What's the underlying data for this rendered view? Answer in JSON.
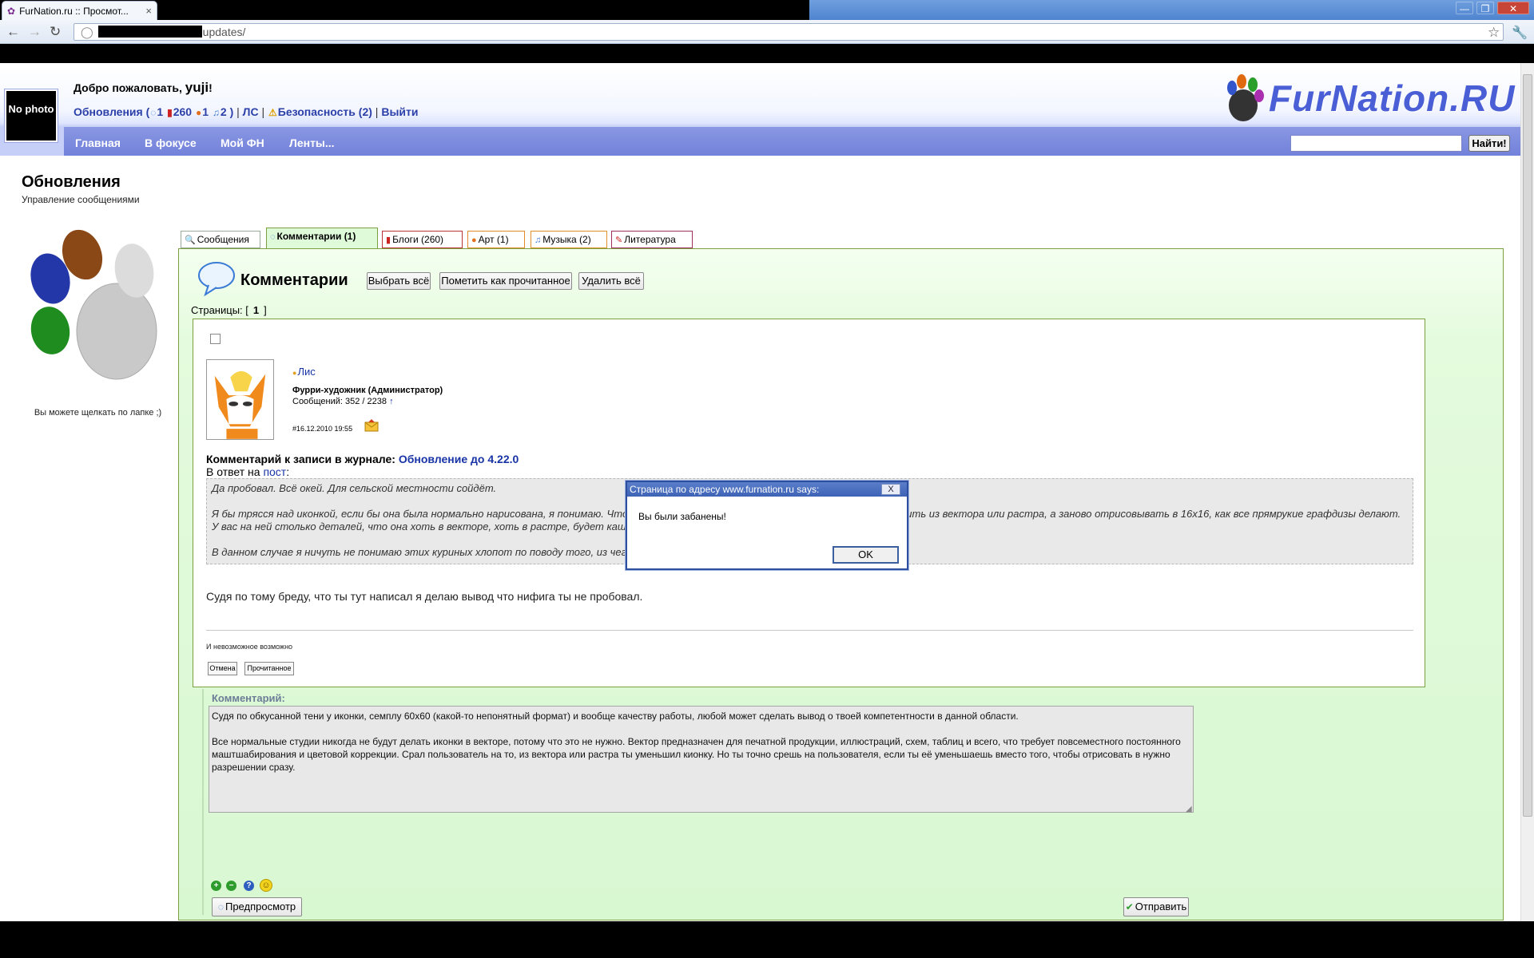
{
  "browser": {
    "tab_title": "FurNation.ru :: Просмот...",
    "tab_close": "×",
    "url_tail": "updates/",
    "min": "—",
    "max": "❐",
    "close": "✕"
  },
  "header": {
    "welcome_prefix": "Добро пожаловать,",
    "username": "yuji",
    "welcome_suffix": "!",
    "no_photo": "No photo",
    "status": {
      "updates_label": "Обновления (",
      "comments_count": "1",
      "blogs_count": "260",
      "art_count": "1",
      "music_count": "2",
      "close_paren": ")",
      "pm": "ЛС",
      "security": "Безопасность (2)",
      "logout": "Выйти"
    },
    "logo_text": "FurNation.RU",
    "nav": [
      "Главная",
      "В фокусе",
      "Мой ФН",
      "Ленты..."
    ],
    "search_button": "Найти!"
  },
  "page": {
    "title": "Обновления",
    "subtitle": "Управление сообщениями",
    "paw_caption": "Вы можете щелкать по лапке ;)"
  },
  "tabs": [
    {
      "label": "Сообщения"
    },
    {
      "label": "Комментарии (1)"
    },
    {
      "label": "Блоги (260)"
    },
    {
      "label": "Арт (1)"
    },
    {
      "label": "Музыка (2)"
    },
    {
      "label": "Литература"
    }
  ],
  "section": {
    "heading": "Комментарии",
    "select_all": "Выбрать всё",
    "mark_read": "Пометить как прочитанное",
    "delete_all": "Удалить всё",
    "pages_label": "Страницы: [",
    "pages_current": "1",
    "pages_close": "]"
  },
  "comment": {
    "author": "Лис",
    "role": "Фурри-художник (Администратор)",
    "posts": "Сообщений: 352 / 2238",
    "posts_arrow": "↑",
    "date": "#16.12.2010 19:55",
    "journal_prefix": "Комментарий к записи в журнале:",
    "journal_link": "Обновление до 4.22.0",
    "reply_prefix": "В ответ на",
    "reply_link": "пост",
    "reply_suffix": ":",
    "quote": [
      "Да пробовал. Всё окей. Для сельской местности сойдёт.",
      "Я бы трясся над иконкой, если бы она была нормально нарисована, я понимаю. Чтобы она не потеряла лицо, её вообще надо не даунсемплить из вектора или растра, а заново отрисовывать в 16х16, как все прямрукие графдизы делают. У вас на ней столько деталей, что она хоть в векторе, хоть в растре, будет кашей при даунсемпле.",
      "В данном случае я ничуть не понимаю этих куриных хлопот по поводу того, из чего она сделана изначально."
    ],
    "body": "Судя по тому бреду, что ты тут написал я делаю вывод что нифига ты не пробовал.",
    "signature": "И невозможное возможно",
    "cancel": "Отмена",
    "read": "Прочитанное"
  },
  "reply_form": {
    "label": "Комментарий:",
    "text": "Судя по обкусанной тени у иконки, семплу 60х60 (какой-то непонятный формат) и вообще качеству работы, любой может сделать вывод о твоей компетентности в данной области.\n\nВсе нормальные студии никогда не будут делать иконки в векторе, потому что это не нужно. Вектор предназначен для печатной продукции, иллюстраций, схем, таблиц и всего, что требует повсеместного постоянного маштшабирования и цветовой коррекции. Срал пользователь на то, из вектора или растра ты уменьшил кионку. Но ты точно срешь на пользователя, если ты её уменьшаешь вместо того, чтобы отрисовать в нужно разрешении сразу.",
    "preview": "Предпросмотр",
    "send": "Отправить"
  },
  "dialog": {
    "title": "Страница по адресу www.furnation.ru says:",
    "close": "X",
    "message": "Вы были забанены!",
    "ok": "OK"
  },
  "colors": {
    "link": "#1733a6",
    "nav_band": "#7a87dd",
    "panel_green": "#dcf8d4",
    "panel_border": "#7ba040"
  }
}
